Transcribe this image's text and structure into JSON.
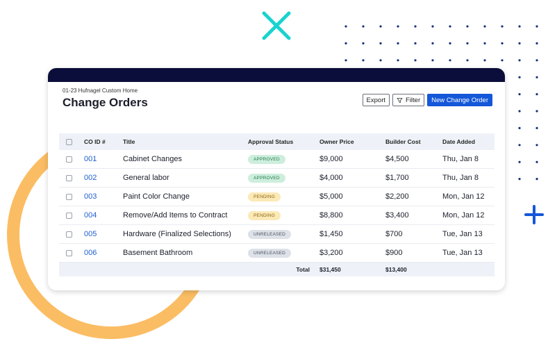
{
  "project": "01-23 Hufnagel Custom Home",
  "title": "Change Orders",
  "toolbar": {
    "export_label": "Export",
    "filter_label": "Filter",
    "new_label": "New Change Order"
  },
  "columns": [
    "CO ID #",
    "Title",
    "Approval Status",
    "Owner Price",
    "Builder Cost",
    "Date Added"
  ],
  "rows": [
    {
      "id": "001",
      "title": "Cabinet Changes",
      "status": "APPROVED",
      "owner_price": "$9,000",
      "builder_cost": "$4,500",
      "date": "Thu, Jan 8"
    },
    {
      "id": "002",
      "title": "General labor",
      "status": "APPROVED",
      "owner_price": "$4,000",
      "builder_cost": "$1,700",
      "date": "Thu, Jan 8"
    },
    {
      "id": "003",
      "title": "Paint Color Change",
      "status": "PENDING",
      "owner_price": "$5,000",
      "builder_cost": "$2,200",
      "date": "Mon, Jan 12"
    },
    {
      "id": "004",
      "title": "Remove/Add Items to Contract",
      "status": "PENDING",
      "owner_price": "$8,800",
      "builder_cost": "$3,400",
      "date": "Mon, Jan 12"
    },
    {
      "id": "005",
      "title": "Hardware (Finalized Selections)",
      "status": "UNRELEASED",
      "owner_price": "$1,450",
      "builder_cost": "$700",
      "date": "Tue, Jan 13"
    },
    {
      "id": "006",
      "title": "Basement Bathroom",
      "status": "UNRELEASED",
      "owner_price": "$3,200",
      "builder_cost": "$900",
      "date": "Tue, Jan 13"
    }
  ],
  "totals": {
    "label": "Total",
    "owner_price": "$31,450",
    "builder_cost": "$13,400"
  },
  "colors": {
    "accent_blue": "#1457d9",
    "navy": "#0b0e3a",
    "ring": "#fbbd63",
    "x_mark": "#19d3cf",
    "approved_bg": "#cdeedd",
    "pending_bg": "#fbe9b7",
    "unreleased_bg": "#dde1e8"
  }
}
